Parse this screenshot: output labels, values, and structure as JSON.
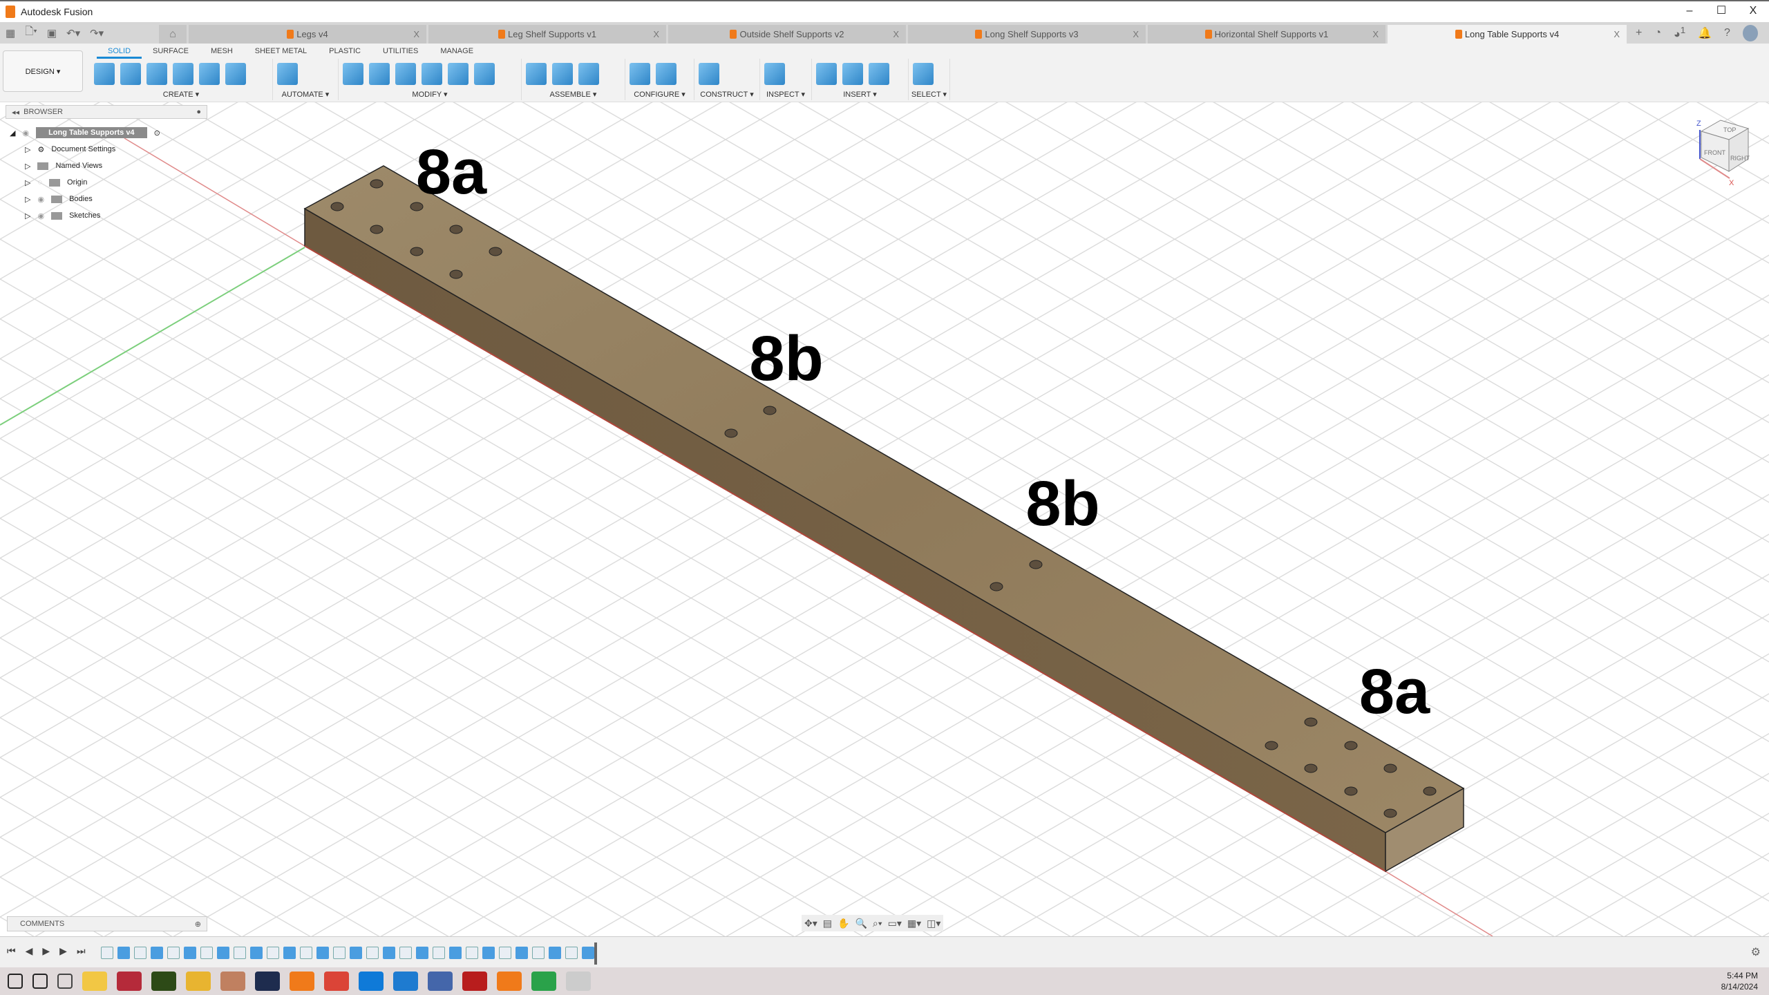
{
  "app": {
    "title": "Autodesk Fusion",
    "window_controls": [
      "–",
      "☐",
      "X"
    ]
  },
  "tabs": [
    {
      "label": "Legs v4",
      "active": false
    },
    {
      "label": "Leg Shelf Supports v1",
      "active": false
    },
    {
      "label": "Outside Shelf Supports v2",
      "active": false
    },
    {
      "label": "Long Shelf Supports v3",
      "active": false
    },
    {
      "label": "Horizontal Shelf Supports v1",
      "active": false
    },
    {
      "label": "Long Table Supports v4",
      "active": true
    }
  ],
  "tab_close": "X",
  "notification_count": "1",
  "toolbar": {
    "workspace": "DESIGN ▾",
    "ribbon_tabs": [
      "SOLID",
      "SURFACE",
      "MESH",
      "SHEET METAL",
      "PLASTIC",
      "UTILITIES",
      "MANAGE"
    ],
    "groups": [
      {
        "label": "CREATE ▾",
        "icons": 6
      },
      {
        "label": "AUTOMATE ▾",
        "icons": 1
      },
      {
        "label": "MODIFY ▾",
        "icons": 6
      },
      {
        "label": "ASSEMBLE ▾",
        "icons": 3
      },
      {
        "label": "CONFIGURE ▾",
        "icons": 2
      },
      {
        "label": "CONSTRUCT ▾",
        "icons": 1
      },
      {
        "label": "INSPECT ▾",
        "icons": 1
      },
      {
        "label": "INSERT ▾",
        "icons": 3
      },
      {
        "label": "SELECT ▾",
        "icons": 1
      }
    ]
  },
  "browser": {
    "title": "BROWSER",
    "root": "Long Table Supports v4",
    "items": [
      "Document Settings",
      "Named Views",
      "Origin",
      "Bodies",
      "Sketches"
    ]
  },
  "comments": {
    "title": "COMMENTS"
  },
  "viewcube": {
    "top": "TOP",
    "front": "FRONT",
    "right": "RIGHT",
    "z": "Z",
    "x": "X"
  },
  "annotations": [
    "8a",
    "8b",
    "8b",
    "8a"
  ],
  "colors": {
    "accent": "#1a8ad4",
    "wood": "#8b7355",
    "x_axis": "#d9534f",
    "y_axis": "#5cb85c"
  },
  "taskbar": {
    "time": "5:44 PM",
    "date": "8/14/2024"
  }
}
